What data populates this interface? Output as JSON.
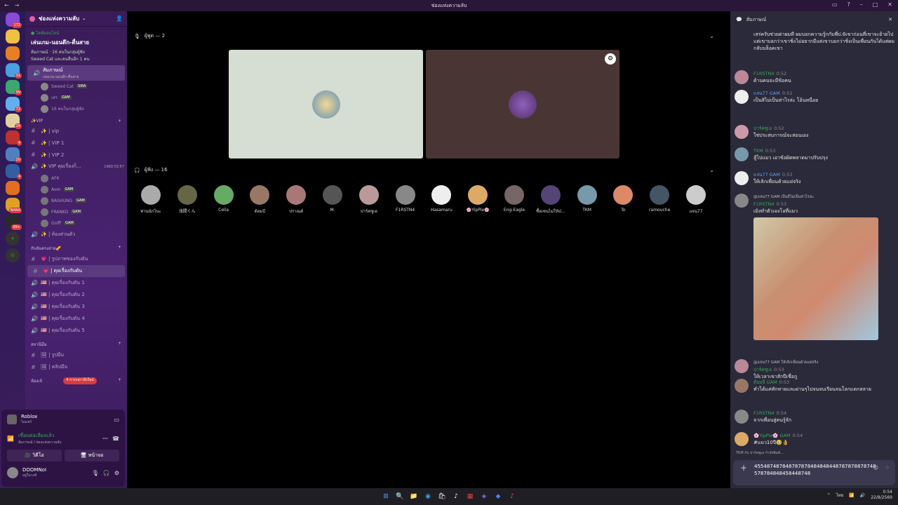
{
  "window": {
    "title": "ช่องแห่งความลับ"
  },
  "servers": [
    {
      "color": "#8a4ad8",
      "badge": "172"
    },
    {
      "color": "#f0c040",
      "badge": ""
    },
    {
      "color": "#e88020",
      "badge": ""
    },
    {
      "color": "#4aa0e0",
      "badge": "31"
    },
    {
      "color": "#3aa870",
      "badge": "99"
    },
    {
      "color": "#60b0f0",
      "badge": "72"
    },
    {
      "color": "#e0d0a0",
      "badge": "24"
    },
    {
      "color": "#c03030",
      "badge": "4"
    },
    {
      "color": "#5080c0",
      "badge": "20"
    },
    {
      "color": "#3060a0",
      "badge": "4"
    },
    {
      "color": "#e07020",
      "badge": ""
    },
    {
      "color": "#e0a020",
      "badge": "NANA"
    },
    {
      "color": "#2a2a2a",
      "badge": "99+"
    }
  ],
  "sidebar": {
    "server_name": "ช่องแห่งความลับ",
    "event": {
      "live": "● ไลฟ์ออนไลน์",
      "name": "เล่นเกม-นอนดึก-ตื่นสาย",
      "line1": "ส้มภาษณ์ · 16 คนในกลุ่มผู้ฟัง",
      "line2": "Sweed Cat และคนอื่นอีก 1 คน"
    },
    "voice_channel": {
      "name": "สัมภาษณ์",
      "topic": "เล่นเกม-นอนดึก-ตื่นสาย"
    },
    "voice_users": [
      {
        "name": "Sweed Cat",
        "tag": "SIRA"
      },
      {
        "name": "เสร",
        "tag": "GAM"
      },
      {
        "name": "16 คนในกลุ่มผู้ฟัง",
        "tag": ""
      }
    ],
    "vip_category": "✨VIP",
    "channels_vip": [
      {
        "icon": "#",
        "label": "✨ | vip"
      },
      {
        "icon": "#",
        "label": "✨ | VIP 1"
      },
      {
        "icon": "#",
        "label": "✨ | VIP 2"
      },
      {
        "icon": "🔊",
        "label": "✨ VIP คุยเรื่องก็...",
        "time": "1960:53:57"
      }
    ],
    "vip_users": [
      {
        "name": "AFK",
        "tag": ""
      },
      {
        "name": "Aom",
        "tag": "GAM"
      },
      {
        "name": "BASHUNG",
        "tag": "GAM"
      },
      {
        "name": "FRANKO",
        "tag": "GAM"
      },
      {
        "name": "Golff",
        "tag": "GAM"
      }
    ],
    "room_private": "✨ | ห้องส่วนตัว",
    "cat2": "กับอันตรงถ่าย🥜",
    "channels2": [
      {
        "icon": "#",
        "label": "💗 | รูปภาพของกับดัน"
      },
      {
        "icon": "#",
        "label": "💗 | คุยเรื่องกับดัน",
        "active": true
      },
      {
        "icon": "🔊",
        "label": "🇺🇸 | คุยเรื่องกับดัน 1"
      },
      {
        "icon": "🔊",
        "label": "🇺🇸 | คุยเรื่องกับดัน 2"
      },
      {
        "icon": "🔊",
        "label": "🇺🇸 | คุยเรื่องกับดัน 3"
      },
      {
        "icon": "🔊",
        "label": "🇺🇸 | คุยเรื่องกับดัน 4"
      },
      {
        "icon": "🔊",
        "label": "🇺🇸 | คุยเรื่องกับดัน 5"
      }
    ],
    "cat3": "สถานีมีม",
    "channels3": [
      {
        "icon": "#",
        "label": "🖼 | รูปมีม"
      },
      {
        "icon": "#",
        "label": "🖼 | คลิปมีม"
      }
    ],
    "cat4": "ห้องเจ้",
    "new_mentions": "4 การกล่าวถึงใหม่"
  },
  "user_panel": {
    "game": "Roblox",
    "game_sub": "ไม่แชร์",
    "voice_status": "เชื่อมต่อเสียงแล้ว",
    "voice_sub": "สัมภาษณ์ / ช่องแห่งความลับ",
    "video_btn": "วิดีโอ",
    "screen_btn": "หน้าจอ",
    "username": "DOOMNoI",
    "user_status": "อยู่ในวงท์"
  },
  "stage": {
    "speakers_label": "ผู้พูด — 2",
    "audience_label": "ผู้ฟัง — 16",
    "audience": [
      "ท่านนักไนะ",
      "浅間くん",
      "Celia",
      "ต้อมบี",
      "ปราณต์",
      "M.",
      "ปาร์คซูเอ",
      "F1RSTN4",
      "Hasamaru",
      "🌸YipPie🌸",
      "Eng-Eagle",
      "ซื้อเซนไม่ให้ป่...",
      "TKM",
      "To",
      "ramouche",
      "แจน77"
    ]
  },
  "chat": {
    "channel": "สัมภาษณ์",
    "messages": [
      {
        "author": "",
        "time": "",
        "text": "เสร่ครับช่วยด่าผมที ผมบอกความรู้กกับพี่ป.6เขาก่อนที่เขาจะย้ายไปแต่เขาบอกว่าเขาชิ่งไม่อยากมีแต่เขาบอกว่าชิ่งเป็นเพื่อนกันได้แต่ผมกลับบล็อคเขา",
        "color": "#fff"
      },
      {
        "author": "F1RSTN4",
        "time": "0:52",
        "text": "ด้านคนจะมีข้อคน",
        "color": "#3ba55d"
      },
      {
        "author": "แจน77 GAM",
        "time": "0:52",
        "text": "เป็นสิไม่เป็นห่าไรล่ะ โอ้นหนื่อย",
        "color": "#5aa0f0"
      },
      {
        "author": "ปาร์คซูเอ",
        "time": "0:52",
        "text": "ใช่ประสบการณ์จะสอนเอง",
        "color": "#3ba55d"
      },
      {
        "author": "TKM",
        "time": "0:53",
        "text": "สู้ไปแมว เอาข้อผิดพลาดมาปรับปรุง",
        "color": "#3ba55d"
      },
      {
        "author": "แจน77 GAM",
        "time": "0:53",
        "text": "ให้เลิกเพื่อนด้วยแย่จริง",
        "color": "#5aa0f0"
      },
      {
        "author": "F1RSTN4",
        "time": "0:53",
        "text": "เมิงทำตัวเองโอที่แมว",
        "color": "#3ba55d",
        "reply": "@แจน77 GAM เป็นสิไม่เป็นห่าไรล่ะ"
      },
      {
        "author": "ปาร์คซูเอ",
        "time": "0:53",
        "text": "ให้เวลาเขาสักปีเชื่อกู",
        "color": "#3ba55d",
        "reply": "@แจน77 GAM ให้เลิกเพื่อนด้วยแย่จริง"
      },
      {
        "author": "ต้อมบี GAM",
        "time": "0:53",
        "text": "ทำได้แค่ทักทายและผ่านๆไปจนจบเรียนจนโลกแตกสลาย",
        "color": "#3ba55d"
      },
      {
        "author": "F1RSTN4",
        "time": "0:54",
        "text": "จากเพื่อนสู่คนรู้จัก",
        "color": "#3ba55d"
      },
      {
        "author": "🌸YipPie🌸 GAM",
        "time": "0:54",
        "text": "#แมว10ปี🥹👌",
        "color": "#3ba55d"
      }
    ],
    "typing": "TKM กับ ปาร์คซูเอ กำลังพิมพ์...",
    "composer_text": "455487487848787878484848448787878878748578784848458448748"
  },
  "taskbar": {
    "time": "0:54",
    "date": "22/8/2569"
  }
}
